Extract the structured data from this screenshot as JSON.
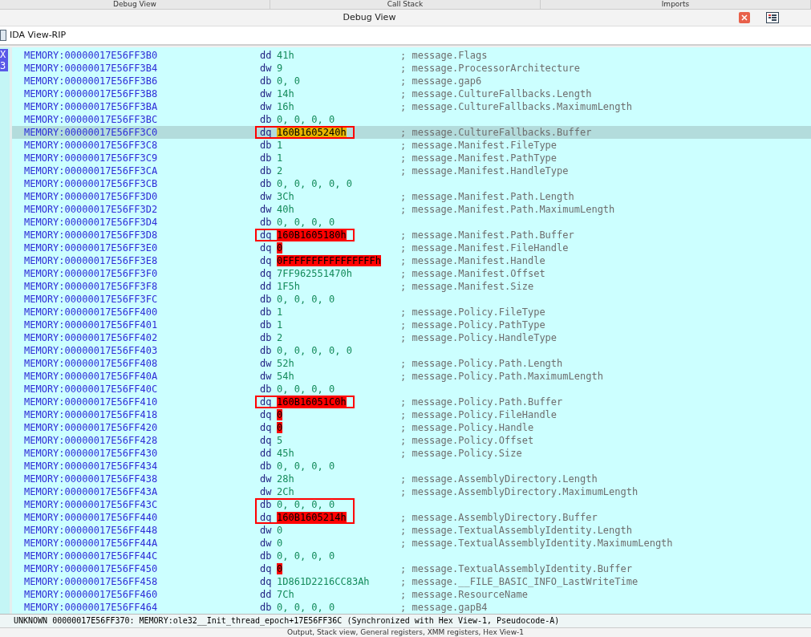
{
  "top_tabs": [
    {
      "label": "Debug View"
    },
    {
      "label": "Call Stack"
    },
    {
      "label": "Imports"
    }
  ],
  "panel": {
    "title": "Debug View"
  },
  "view_tab": {
    "label": "IDA View-RIP"
  },
  "gutter_marks": [
    "X",
    "3"
  ],
  "rows": [
    {
      "address": "MEMORY:00000017E56FF3B0",
      "type": "dd",
      "value": "41h",
      "comment": "; message.Flags",
      "selected": false,
      "boxed": false
    },
    {
      "address": "MEMORY:00000017E56FF3B4",
      "type": "dw",
      "value": "9",
      "comment": "; message.ProcessorArchitecture",
      "selected": false,
      "boxed": false
    },
    {
      "address": "MEMORY:00000017E56FF3B6",
      "type": "db",
      "value": "0, 0",
      "comment": "; message.gap6",
      "selected": false,
      "boxed": false
    },
    {
      "address": "MEMORY:00000017E56FF3B8",
      "type": "dw",
      "value": "14h",
      "comment": "; message.CultureFallbacks.Length",
      "selected": false,
      "boxed": false
    },
    {
      "address": "MEMORY:00000017E56FF3BA",
      "type": "dw",
      "value": "16h",
      "comment": "; message.CultureFallbacks.MaximumLength",
      "selected": false,
      "boxed": false
    },
    {
      "address": "MEMORY:00000017E56FF3BC",
      "type": "db",
      "value": "0, 0, 0, 0",
      "selected": false,
      "boxed": false
    },
    {
      "address": "MEMORY:00000017E56FF3C0",
      "type": "dq",
      "value": "160B1605240h",
      "comment": "; message.CultureFallbacks.Buffer",
      "color": "#e8b400",
      "selected": true,
      "boxed": true
    },
    {
      "address": "MEMORY:00000017E56FF3C8",
      "type": "db",
      "value": "1",
      "comment": "; message.Manifest.FileType",
      "selected": false,
      "boxed": false
    },
    {
      "address": "MEMORY:00000017E56FF3C9",
      "type": "db",
      "value": "1",
      "comment": "; message.Manifest.PathType",
      "selected": false,
      "boxed": false
    },
    {
      "address": "MEMORY:00000017E56FF3CA",
      "type": "db",
      "value": "2",
      "comment": "; message.Manifest.HandleType",
      "selected": false,
      "boxed": false
    },
    {
      "address": "MEMORY:00000017E56FF3CB",
      "type": "db",
      "value": "0, 0, 0, 0, 0",
      "selected": false,
      "boxed": false
    },
    {
      "address": "MEMORY:00000017E56FF3D0",
      "type": "dw",
      "value": "3Ch",
      "comment": "; message.Manifest.Path.Length",
      "selected": false,
      "boxed": false
    },
    {
      "address": "MEMORY:00000017E56FF3D2",
      "type": "dw",
      "value": "40h",
      "comment": "; message.Manifest.Path.MaximumLength",
      "selected": false,
      "boxed": false
    },
    {
      "address": "MEMORY:00000017E56FF3D4",
      "type": "db",
      "value": "0, 0, 0, 0",
      "selected": false,
      "boxed": false
    },
    {
      "address": "MEMORY:00000017E56FF3D8",
      "type": "dq",
      "value": "160B1605180h",
      "comment": "; message.Manifest.Path.Buffer",
      "color": "#ff0000",
      "selected": false,
      "boxed": true
    },
    {
      "address": "MEMORY:00000017E56FF3E0",
      "type": "dq",
      "value": "0",
      "comment": "; message.Manifest.FileHandle",
      "color": "#ff0000",
      "selected": false,
      "boxed": false
    },
    {
      "address": "MEMORY:00000017E56FF3E8",
      "type": "dq",
      "value": "0FFFFFFFFFFFFFFFFh",
      "comment": "; message.Manifest.Handle",
      "color": "#ff0000",
      "selected": false,
      "boxed": false
    },
    {
      "address": "MEMORY:00000017E56FF3F0",
      "type": "dq",
      "value": "7FF962551470h",
      "comment": "; message.Manifest.Offset",
      "selected": false,
      "boxed": false
    },
    {
      "address": "MEMORY:00000017E56FF3F8",
      "type": "dd",
      "value": "1F5h",
      "comment": "; message.Manifest.Size",
      "selected": false,
      "boxed": false
    },
    {
      "address": "MEMORY:00000017E56FF3FC",
      "type": "db",
      "value": "0, 0, 0, 0",
      "selected": false,
      "boxed": false
    },
    {
      "address": "MEMORY:00000017E56FF400",
      "type": "db",
      "value": "1",
      "comment": "; message.Policy.FileType",
      "selected": false,
      "boxed": false
    },
    {
      "address": "MEMORY:00000017E56FF401",
      "type": "db",
      "value": "1",
      "comment": "; message.Policy.PathType",
      "selected": false,
      "boxed": false
    },
    {
      "address": "MEMORY:00000017E56FF402",
      "type": "db",
      "value": "2",
      "comment": "; message.Policy.HandleType",
      "selected": false,
      "boxed": false
    },
    {
      "address": "MEMORY:00000017E56FF403",
      "type": "db",
      "value": "0, 0, 0, 0, 0",
      "selected": false,
      "boxed": false
    },
    {
      "address": "MEMORY:00000017E56FF408",
      "type": "dw",
      "value": "52h",
      "comment": "; message.Policy.Path.Length",
      "selected": false,
      "boxed": false
    },
    {
      "address": "MEMORY:00000017E56FF40A",
      "type": "dw",
      "value": "54h",
      "comment": "; message.Policy.Path.MaximumLength",
      "selected": false,
      "boxed": false
    },
    {
      "address": "MEMORY:00000017E56FF40C",
      "type": "db",
      "value": "0, 0, 0, 0",
      "selected": false,
      "boxed": false
    },
    {
      "address": "MEMORY:00000017E56FF410",
      "type": "dq",
      "value": "160B16051C0h",
      "comment": "; message.Policy.Path.Buffer",
      "color": "#ff0000",
      "selected": false,
      "boxed": true
    },
    {
      "address": "MEMORY:00000017E56FF418",
      "type": "dq",
      "value": "0",
      "comment": "; message.Policy.FileHandle",
      "color": "#ff0000",
      "selected": false,
      "boxed": false
    },
    {
      "address": "MEMORY:00000017E56FF420",
      "type": "dq",
      "value": "0",
      "comment": "; message.Policy.Handle",
      "color": "#ff0000",
      "selected": false,
      "boxed": false
    },
    {
      "address": "MEMORY:00000017E56FF428",
      "type": "dq",
      "value": "5",
      "comment": "; message.Policy.Offset",
      "selected": false,
      "boxed": false
    },
    {
      "address": "MEMORY:00000017E56FF430",
      "type": "dd",
      "value": "45h",
      "comment": "; message.Policy.Size",
      "selected": false,
      "boxed": false
    },
    {
      "address": "MEMORY:00000017E56FF434",
      "type": "db",
      "value": "0, 0, 0, 0",
      "selected": false,
      "boxed": false
    },
    {
      "address": "MEMORY:00000017E56FF438",
      "type": "dw",
      "value": "28h",
      "comment": "; message.AssemblyDirectory.Length",
      "selected": false,
      "boxed": false
    },
    {
      "address": "MEMORY:00000017E56FF43A",
      "type": "dw",
      "value": "2Ch",
      "comment": "; message.AssemblyDirectory.MaximumLength",
      "selected": false,
      "boxed": false
    },
    {
      "address": "MEMORY:00000017E56FF43C",
      "type": "db",
      "value": "0, 0, 0, 0",
      "selected": false,
      "boxed": true
    },
    {
      "address": "MEMORY:00000017E56FF440",
      "type": "dq",
      "value": "160B1605214h",
      "comment": "; message.AssemblyDirectory.Buffer",
      "color": "#ff0000",
      "selected": false,
      "boxed": true
    },
    {
      "address": "MEMORY:00000017E56FF448",
      "type": "dw",
      "value": "0",
      "comment": "; message.TextualAssemblyIdentity.Length",
      "selected": false,
      "boxed": false
    },
    {
      "address": "MEMORY:00000017E56FF44A",
      "type": "dw",
      "value": "0",
      "comment": "; message.TextualAssemblyIdentity.MaximumLength",
      "selected": false,
      "boxed": false
    },
    {
      "address": "MEMORY:00000017E56FF44C",
      "type": "db",
      "value": "0, 0, 0, 0",
      "selected": false,
      "boxed": false
    },
    {
      "address": "MEMORY:00000017E56FF450",
      "type": "dq",
      "value": "0",
      "comment": "; message.TextualAssemblyIdentity.Buffer",
      "color": "#ff0000",
      "selected": false,
      "boxed": false
    },
    {
      "address": "MEMORY:00000017E56FF458",
      "type": "dq",
      "value": "1D861D2216CC83Ah",
      "comment": "; message.__FILE_BASIC_INFO_LastWriteTime",
      "selected": false,
      "boxed": false
    },
    {
      "address": "MEMORY:00000017E56FF460",
      "type": "dd",
      "value": "7Ch",
      "comment": "; message.ResourceName",
      "selected": false,
      "boxed": false
    },
    {
      "address": "MEMORY:00000017E56FF464",
      "type": "db",
      "value": "0, 0, 0, 0",
      "comment": "; message.gapB4",
      "selected": false,
      "boxed": false
    }
  ],
  "status_bar": {
    "state": "UNKNOWN",
    "location": "00000017E56FF370: MEMORY:ole32__Init_thread_epoch+17E56FF36C (Synchronized with Hex View-1, Pseudocode-A)"
  },
  "bottom_tabs": {
    "label": "Output, Stack view, General registers, XMM registers, Hex View-1"
  }
}
